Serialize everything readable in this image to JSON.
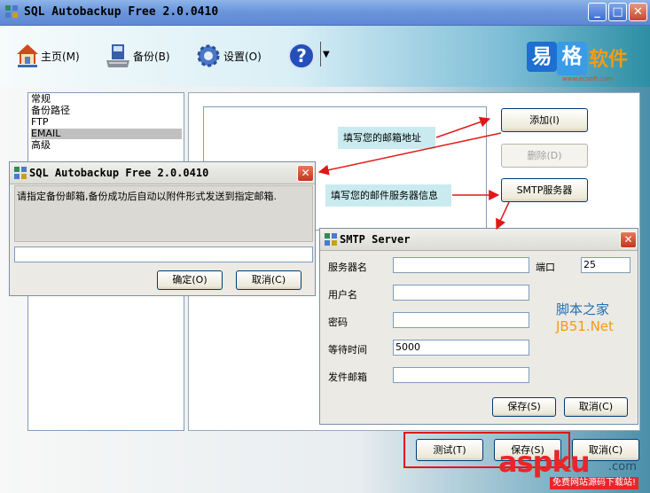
{
  "window": {
    "title": "SQL Autobackup Free 2.0.0410",
    "minimize": "_",
    "maximize": "□",
    "close": "✕"
  },
  "toolbar": {
    "home": "主页(M)",
    "backup": "备份(B)",
    "settings": "设置(O)",
    "help_glyph": "?",
    "help_arrow": "▼"
  },
  "brand": {
    "glyph1": "易",
    "glyph2": "格",
    "word": "软件",
    "sub": "www.ecsoft.com"
  },
  "categories": [
    "常规",
    "备份路径",
    "FTP",
    "EMAIL",
    "高级"
  ],
  "selected_category": "EMAIL",
  "email_panel": {
    "add_button": "添加(I)",
    "delete_button": "删除(D)",
    "smtp_button": "SMTP服务器"
  },
  "callouts": {
    "mail_address": "填写您的邮箱地址",
    "mail_server": "填写您的邮件服务器信息"
  },
  "footer_buttons": {
    "test": "测试(T)",
    "save": "保存(S)",
    "cancel": "取消(C)"
  },
  "dialog_email": {
    "title": "SQL Autobackup Free 2.0.0410",
    "message": "请指定备份邮箱,备份成功后自动以附件形式发送到指定邮箱.",
    "input_value": "",
    "ok": "确定(O)",
    "cancel": "取消(C)"
  },
  "dialog_smtp": {
    "title": "SMTP Server",
    "server_label": "服务器名",
    "server_value": "",
    "port_label": "端口",
    "port_value": "25",
    "user_label": "用户名",
    "user_value": "",
    "password_label": "密码",
    "password_value": "",
    "timeout_label": "等待时间",
    "timeout_value": "5000",
    "sender_label": "发件邮箱",
    "sender_value": "",
    "save": "保存(S)",
    "cancel": "取消(C)"
  },
  "watermarks": {
    "jb51_line1": "脚本之家",
    "jb51_line2": "JB51.Net"
  },
  "site_logo": {
    "name": "aspku",
    "tld": ".com",
    "slogan": "免费网站源码下载站!"
  },
  "colors": {
    "accent_red": "#e01818",
    "callout_bg": "#c9ebef",
    "title_blue": "#6b96dc"
  }
}
